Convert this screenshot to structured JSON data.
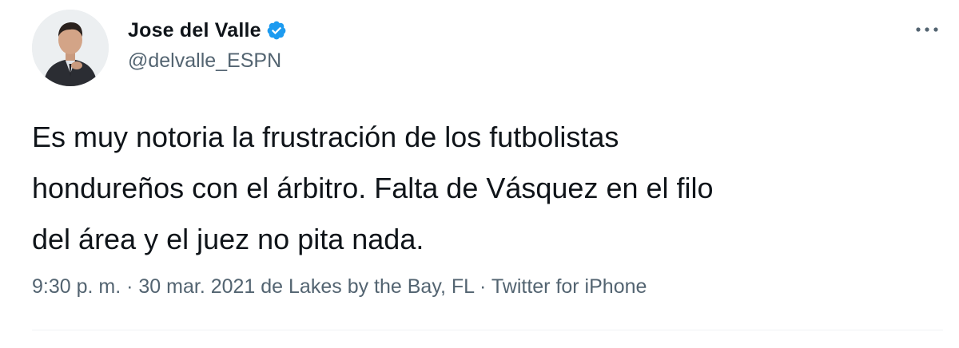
{
  "author": {
    "display_name": "Jose del Valle",
    "handle": "@delvalle_ESPN",
    "verified": true
  },
  "more_icon": "more-horizontal-icon",
  "tweet": {
    "text": "Es muy notoria la frustración de los futbolistas\nhondureños con el árbitro. Falta de Vásquez en el filo\ndel área y el juez no pita nada."
  },
  "meta": {
    "time": "9:30 p. m.",
    "separator": " · ",
    "date": "30 mar. 2021",
    "location_prefix": " de ",
    "location": "Lakes by the Bay, FL",
    "source": "Twitter for iPhone"
  },
  "colors": {
    "verified_blue": "#1d9bf0",
    "text_primary": "#0f1419",
    "text_secondary": "#536471"
  }
}
